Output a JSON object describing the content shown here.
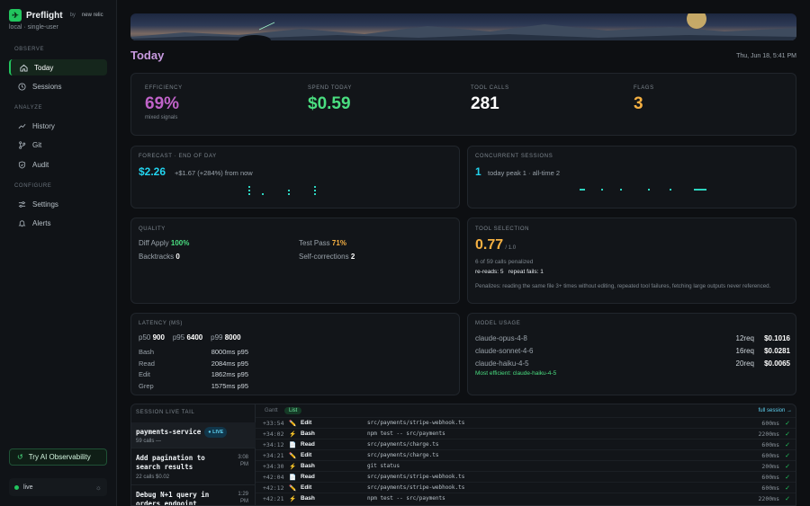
{
  "brand": {
    "name": "Preflight",
    "by": "by",
    "partner": "new relic",
    "subtitle": "local · single-user"
  },
  "nav": {
    "observe_label": "OBSERVE",
    "analyze_label": "ANALYZE",
    "configure_label": "CONFIGURE",
    "items": [
      {
        "label": "Today",
        "icon": "home-icon",
        "active": true
      },
      {
        "label": "Sessions",
        "icon": "clock-icon"
      },
      {
        "label": "History",
        "icon": "trend-icon"
      },
      {
        "label": "Git",
        "icon": "git-branch-icon"
      },
      {
        "label": "Audit",
        "icon": "shield-icon"
      },
      {
        "label": "Settings",
        "icon": "sliders-icon"
      },
      {
        "label": "Alerts",
        "icon": "bell-icon"
      }
    ],
    "ai_button": "Try AI Observability",
    "live_label": "live"
  },
  "page": {
    "title": "Today",
    "date": "Thu, Jun 18, 5:41 PM"
  },
  "kpis": [
    {
      "label": "EFFICIENCY",
      "value": "69%",
      "sub": "mixed signals",
      "color": "#c063c9"
    },
    {
      "label": "SPEND TODAY",
      "value": "$0.59",
      "sub": "",
      "color": "#4ade80"
    },
    {
      "label": "TOOL CALLS",
      "value": "281",
      "sub": "",
      "color": "#ffffff"
    },
    {
      "label": "FLAGS",
      "value": "3",
      "sub": "",
      "color": "#f5b042"
    }
  ],
  "forecast": {
    "label": "FORECAST · END OF DAY",
    "value": "$2.26",
    "delta": "+$1.67 (+284%) from now",
    "color": "#22d3ee"
  },
  "concurrent": {
    "label": "CONCURRENT SESSIONS",
    "value": "1",
    "detail": "today peak 1 · all-time 2"
  },
  "quality": {
    "label": "QUALITY",
    "items": [
      {
        "key": "Diff Apply",
        "value": "100%",
        "color": "#4ade80"
      },
      {
        "key": "Test Pass",
        "value": "71%",
        "color": "#f5b042"
      },
      {
        "key": "Backtracks",
        "value": "0",
        "color": "#ffffff"
      },
      {
        "key": "Self-corrections",
        "value": "2",
        "color": "#ffffff"
      }
    ]
  },
  "tool_selection": {
    "label": "TOOL SELECTION",
    "score": "0.77",
    "max": "/ 1.0",
    "penalized": "6 of 59 calls penalized",
    "rereads": "re-reads: 5",
    "repeat_fails": "repeat fails: 1",
    "note": "Penalizes: reading the same file 3+ times without editing, repeated tool failures, fetching large outputs never referenced."
  },
  "latency": {
    "label": "LATENCY (MS)",
    "p50_label": "p50",
    "p50": "900",
    "p95_label": "p95",
    "p95": "6400",
    "p99_label": "p99",
    "p99": "8000",
    "rows": [
      {
        "tool": "Bash",
        "value": "8000ms p95"
      },
      {
        "tool": "Read",
        "value": "2084ms p95"
      },
      {
        "tool": "Edit",
        "value": "1862ms p95"
      },
      {
        "tool": "Grep",
        "value": "1575ms p95"
      }
    ]
  },
  "model_usage": {
    "label": "MODEL USAGE",
    "rows": [
      {
        "model": "claude-opus-4-8",
        "req": "12req",
        "cost": "$0.1016"
      },
      {
        "model": "claude-sonnet-4-6",
        "req": "16req",
        "cost": "$0.0281"
      },
      {
        "model": "claude-haiku-4-5",
        "req": "20req",
        "cost": "$0.0065"
      }
    ],
    "most_efficient": "Most efficient: claude-haiku-4-5"
  },
  "live_tail": {
    "label": "SESSION LIVE TAIL",
    "tabs": [
      "Gantt",
      "List"
    ],
    "full_session": "full session →",
    "sessions": [
      {
        "title": "payments-service",
        "badge": "LIVE",
        "meta": "59 calls  —",
        "time": ""
      },
      {
        "title": "Add pagination to search results",
        "badge": "",
        "meta": "22 calls  $0.02",
        "time": "3:08 PM"
      },
      {
        "title": "Debug N+1 query in orders endpoint",
        "badge": "",
        "meta": "",
        "time": "1:29 PM"
      }
    ],
    "events": [
      {
        "offset": "+33:54",
        "icon": "pencil-icon",
        "tool": "Edit",
        "arg": "src/payments/stripe-webhook.ts",
        "dur": "600ms"
      },
      {
        "offset": "+34:02",
        "icon": "bolt-icon",
        "tool": "Bash",
        "arg": "npm test -- src/payments",
        "dur": "2200ms"
      },
      {
        "offset": "+34:12",
        "icon": "file-icon",
        "tool": "Read",
        "arg": "src/payments/charge.ts",
        "dur": "600ms"
      },
      {
        "offset": "+34:21",
        "icon": "pencil-icon",
        "tool": "Edit",
        "arg": "src/payments/charge.ts",
        "dur": "600ms"
      },
      {
        "offset": "+34:30",
        "icon": "bolt-icon",
        "tool": "Bash",
        "arg": "git status",
        "dur": "200ms"
      },
      {
        "offset": "+42:04",
        "icon": "file-icon",
        "tool": "Read",
        "arg": "src/payments/stripe-webhook.ts",
        "dur": "600ms"
      },
      {
        "offset": "+42:12",
        "icon": "pencil-icon",
        "tool": "Edit",
        "arg": "src/payments/stripe-webhook.ts",
        "dur": "600ms"
      },
      {
        "offset": "+42:21",
        "icon": "bolt-icon",
        "tool": "Bash",
        "arg": "npm test -- src/payments",
        "dur": "2200ms"
      }
    ]
  }
}
